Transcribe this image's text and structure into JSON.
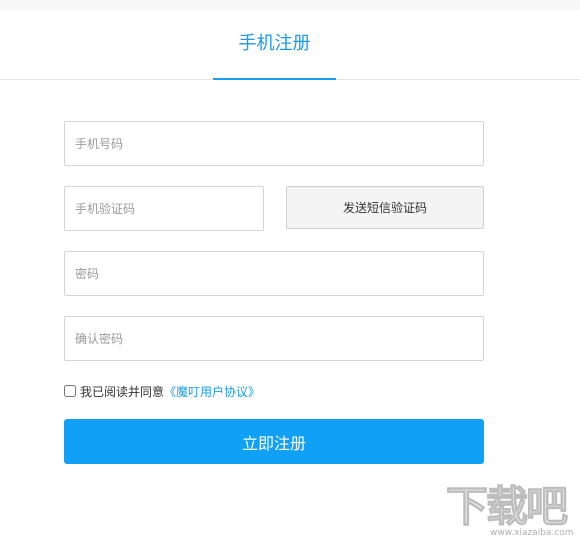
{
  "tabs": [
    {
      "label": "手机注册",
      "active": true
    }
  ],
  "form": {
    "phone_placeholder": "手机号码",
    "code_placeholder": "手机验证码",
    "send_code_label": "发送短信验证码",
    "password_placeholder": "密码",
    "confirm_placeholder": "确认密码",
    "agree_checked": false,
    "agree_text": "我已阅读并同意",
    "agreement_link": "《魔叮用户协议》",
    "submit_label": "立即注册"
  },
  "watermark": {
    "logo_text": "下载吧",
    "url_text": "www.xiazaiba.com"
  },
  "colors": {
    "accent": "#10a0f5",
    "tab_text": "#1a9be6",
    "border": "#d4d4d4",
    "send_button_bg": "#f4f4f4"
  }
}
